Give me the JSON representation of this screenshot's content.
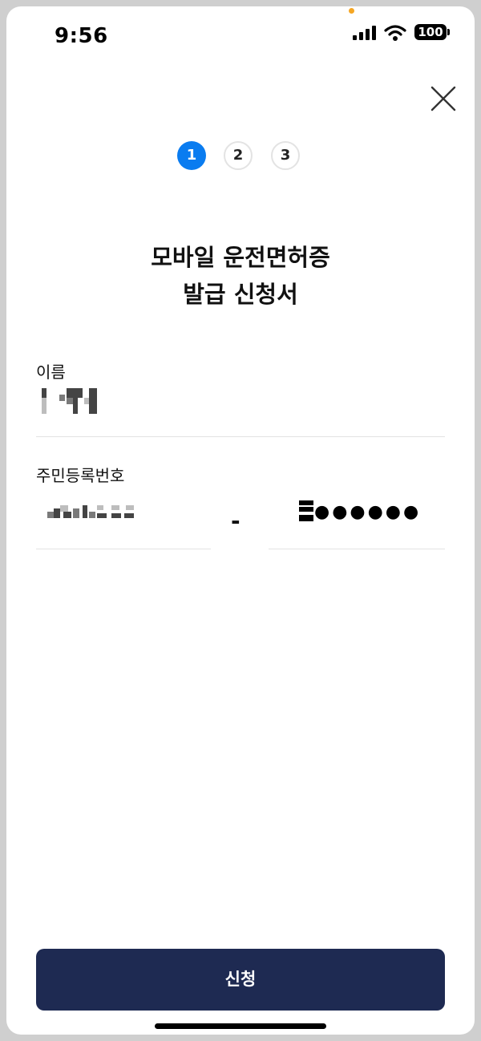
{
  "status_bar": {
    "time": "9:56",
    "battery": "100",
    "icons": [
      "cellular-signal-icon",
      "wifi-icon",
      "battery-icon"
    ]
  },
  "header": {
    "close_icon": "close-icon",
    "steps": [
      "1",
      "2",
      "3"
    ],
    "active_step": 1
  },
  "title": {
    "line1": "모바일 운전면허증",
    "line2": "발급 신청서"
  },
  "form": {
    "name_label": "이름",
    "rrn_label": "주민등록번호",
    "rrn_separator": "-",
    "rrn_back_masked": "●●●●●●"
  },
  "submit_label": "신청",
  "colors": {
    "accent": "#0a7cf0",
    "button": "#1e2a52",
    "divider": "#e3e3e3"
  }
}
